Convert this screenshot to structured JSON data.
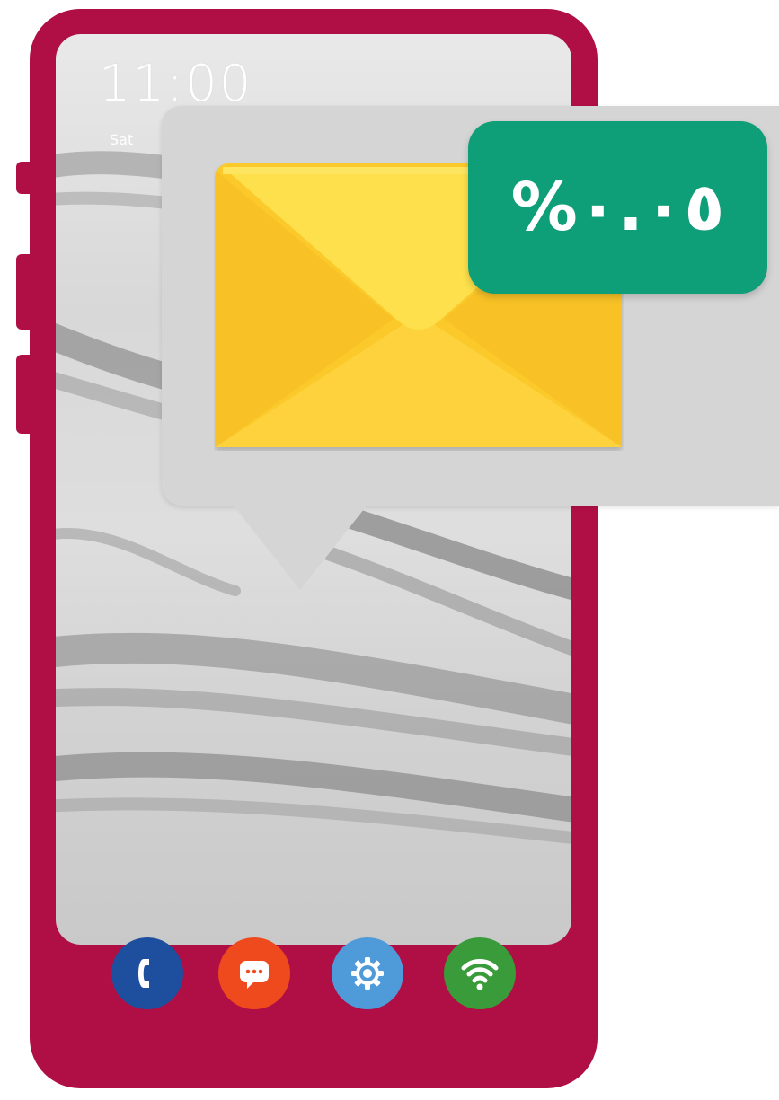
{
  "lock_screen": {
    "time": "11:00",
    "day": "Sat"
  },
  "notification": {
    "badge_text": "%٠.٠٥",
    "icon": "envelope-icon"
  },
  "dock": {
    "apps": [
      {
        "icon": "phone-icon"
      },
      {
        "icon": "message-icon"
      },
      {
        "icon": "settings-icon"
      },
      {
        "icon": "wifi-icon"
      }
    ]
  },
  "colors": {
    "phone_body": "#b00f45",
    "badge": "#0e9e78",
    "envelope": "#fcd031",
    "bubble": "#d5d5d5"
  }
}
